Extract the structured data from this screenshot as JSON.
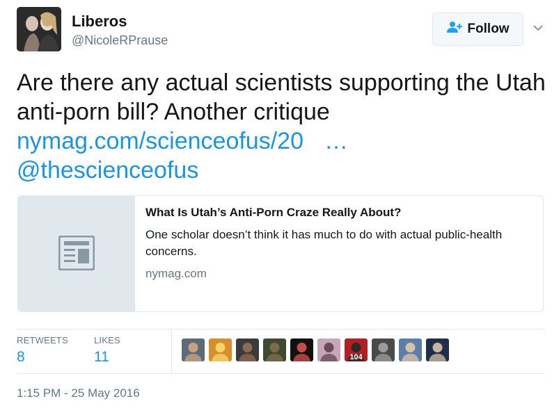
{
  "author": {
    "name": "Liberos",
    "handle": "@NicoleRPrause"
  },
  "follow_button": {
    "label": "Follow"
  },
  "tweet": {
    "text": "Are there any actual scientists supporting the Utah anti-porn bill? Another critique",
    "link": "nymag.com/scienceofus/20",
    "ellipsis": "…",
    "mention": "@thescienceofus"
  },
  "card": {
    "title": "What Is Utah’s Anti-Porn Craze Really About?",
    "description": "One scholar doesn’t think it has much to do with actual public-health concerns.",
    "domain": "nymag.com"
  },
  "stats": {
    "retweets_label": "RETWEETS",
    "retweets_count": "8",
    "likes_label": "LIKES",
    "likes_count": "11"
  },
  "likers": [
    {
      "name": "liker-avatar-1",
      "colors": [
        "#5b6b7a",
        "#c9a27d"
      ]
    },
    {
      "name": "liker-avatar-2",
      "colors": [
        "#d98e2b",
        "#f3d36b"
      ]
    },
    {
      "name": "liker-avatar-3",
      "colors": [
        "#3b3b3b",
        "#8c6a54"
      ]
    },
    {
      "name": "liker-avatar-4",
      "colors": [
        "#3d4a2f",
        "#7d6b4a"
      ]
    },
    {
      "name": "liker-avatar-5",
      "colors": [
        "#111111",
        "#c84b4b"
      ]
    },
    {
      "name": "liker-avatar-6",
      "colors": [
        "#c7a6b7",
        "#6b4b5a"
      ]
    },
    {
      "name": "liker-avatar-7",
      "colors": [
        "#b41f24",
        "#2a2a2a"
      ],
      "text": "104"
    },
    {
      "name": "liker-avatar-8",
      "colors": [
        "#4a4a4a",
        "#9a9a9a"
      ]
    },
    {
      "name": "liker-avatar-9",
      "colors": [
        "#5a7fa8",
        "#d9c2a5"
      ]
    },
    {
      "name": "liker-avatar-10",
      "colors": [
        "#1f2e4a",
        "#c9b5a0"
      ]
    }
  ],
  "timestamp": "1:15 PM - 25 May 2016",
  "colors": {
    "link": "#1b95e0",
    "text": "#14171a",
    "secondary": "#657786",
    "border": "#e1e8ed"
  },
  "icons": {
    "follow": "add-user-icon",
    "caret": "chevron-down-icon",
    "card": "article-icon"
  }
}
